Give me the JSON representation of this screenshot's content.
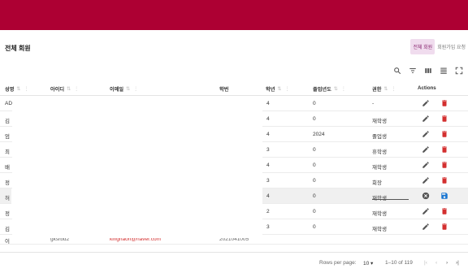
{
  "page": {
    "title": "전체 회원"
  },
  "view_toggle": {
    "all_label": "전체 회원",
    "signup_label": "회원가입 요청"
  },
  "toolbar": {
    "icons": [
      "search-icon",
      "filter-icon",
      "columns-icon",
      "density-icon",
      "fullscreen-icon"
    ]
  },
  "table": {
    "columns": [
      "성명",
      "아이디",
      "이메일",
      "학번",
      "학년",
      "졸업년도",
      "권한",
      "Actions"
    ],
    "rows": [
      {
        "name": "ADMIN",
        "grade": "4",
        "grad_year": "0",
        "role": "-"
      },
      {
        "name": "김",
        "grade": "4",
        "grad_year": "0",
        "role": "재학생"
      },
      {
        "name": "엄",
        "grade": "4",
        "grad_year": "2024",
        "role": "졸업생"
      },
      {
        "name": "최",
        "grade": "3",
        "grad_year": "0",
        "role": "휴학생"
      },
      {
        "name": "배",
        "grade": "4",
        "grad_year": "0",
        "role": "재학생"
      },
      {
        "name": "정",
        "grade": "3",
        "grad_year": "0",
        "role": "회장"
      },
      {
        "name": "허",
        "grade": "4",
        "grad_year": "0",
        "role": "재학생"
      },
      {
        "name": "정",
        "grade": "2",
        "grad_year": "0",
        "role": "재학생"
      },
      {
        "name": "김",
        "grade": "3",
        "grad_year": "0",
        "role": "재학생"
      }
    ],
    "partial_row": {
      "name": "이",
      "user_id": "gksrbd2",
      "email": "kingnaon@naver.com",
      "student_id": "2021041005"
    }
  },
  "footer": {
    "rows_per_page_label": "Rows per page:",
    "rows_per_page_value": "10",
    "range": "1–10 of 119"
  },
  "colors": {
    "brand": "#ad0033",
    "danger": "#d32f2f",
    "primary": "#1976d2"
  }
}
